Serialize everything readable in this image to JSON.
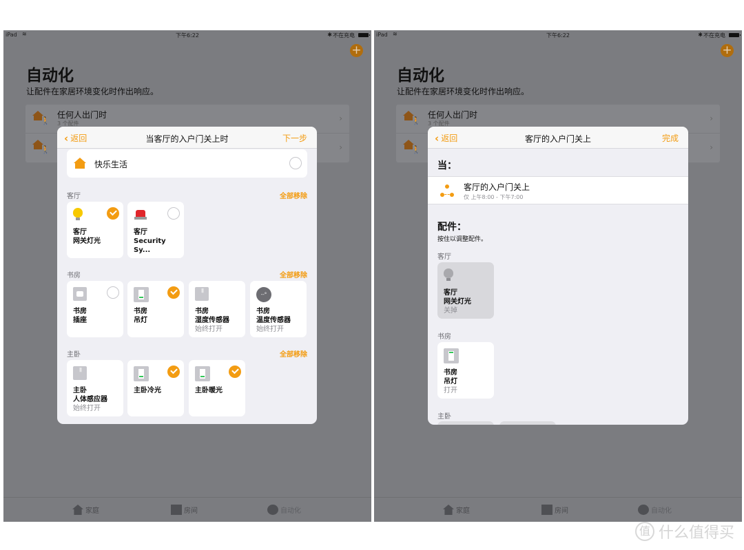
{
  "status_bar": {
    "carrier": "iPad",
    "time": "下午6:22",
    "bluetooth": "✱",
    "charging": "不在充电"
  },
  "background_page": {
    "title": "自动化",
    "subtitle": "让配件在家居环境变化时作出响应。",
    "add_icon": "+",
    "automations": [
      {
        "title": "任何人出门时",
        "subtitle": "3 个配件"
      },
      {
        "title": "",
        "subtitle": ""
      }
    ],
    "tabs": [
      {
        "label": "家庭",
        "icon": "home-icon"
      },
      {
        "label": "房间",
        "icon": "rooms-icon"
      },
      {
        "label": "自动化",
        "icon": "automation-icon"
      }
    ]
  },
  "left_modal": {
    "back_label": "返回",
    "title": "当客厅的入户门关上时",
    "action_label": "下一步",
    "home": {
      "name": "快乐生活",
      "selected": false
    },
    "remove_all_label": "全部移除",
    "sections": [
      {
        "room": "客厅",
        "accessories": [
          {
            "room": "客厅",
            "name": "网关灯光",
            "state": "",
            "icon": "bulb",
            "selected": true
          },
          {
            "room": "客厅",
            "name": "Security Sy...",
            "state": "",
            "icon": "siren",
            "selected": false
          }
        ]
      },
      {
        "room": "书房",
        "accessories": [
          {
            "room": "书房",
            "name": "插座",
            "state": "",
            "icon": "outlet",
            "selected": false
          },
          {
            "room": "书房",
            "name": "吊灯",
            "state": "",
            "icon": "switch",
            "selected": true
          },
          {
            "room": "书房",
            "name": "湿度传感器",
            "state": "始终打开",
            "icon": "sensor",
            "selected": null
          },
          {
            "room": "书房",
            "name": "温度传感器",
            "state": "始终打开",
            "icon": "temperature",
            "temp_text": "--°",
            "selected": null
          }
        ]
      },
      {
        "room": "主卧",
        "accessories": [
          {
            "room": "主卧",
            "name": "人体感应器",
            "state": "始终打开",
            "icon": "sensor",
            "selected": null
          },
          {
            "room": "",
            "name": "主卧冷光",
            "state": "",
            "icon": "switch",
            "selected": true
          },
          {
            "room": "",
            "name": "主卧暖光",
            "state": "",
            "icon": "switch",
            "selected": true
          }
        ]
      }
    ]
  },
  "right_modal": {
    "back_label": "返回",
    "title": "客厅的入户门关上",
    "action_label": "完成",
    "when_label": "当：",
    "trigger": {
      "title": "客厅的入户门关上",
      "subtitle": "仅 上午8:00 - 下午7:00"
    },
    "accessories_label": "配件：",
    "accessories_hint": "按住以调整配件。",
    "sections": [
      {
        "room": "客厅",
        "accessories": [
          {
            "room": "客厅",
            "name": "网关灯光",
            "state": "关掉",
            "icon": "bulb-off"
          }
        ]
      },
      {
        "room": "书房",
        "accessories": [
          {
            "room": "书房",
            "name": "吊灯",
            "state": "打开",
            "icon": "switch"
          }
        ]
      },
      {
        "room": "主卧",
        "accessories": []
      }
    ]
  },
  "watermark": {
    "badge": "值",
    "text": "什么值得买"
  },
  "colors": {
    "accent": "#f39c12",
    "dimmed_background": "#7b7c80",
    "modal_background": "#efeff4",
    "led_green": "#34c759"
  }
}
